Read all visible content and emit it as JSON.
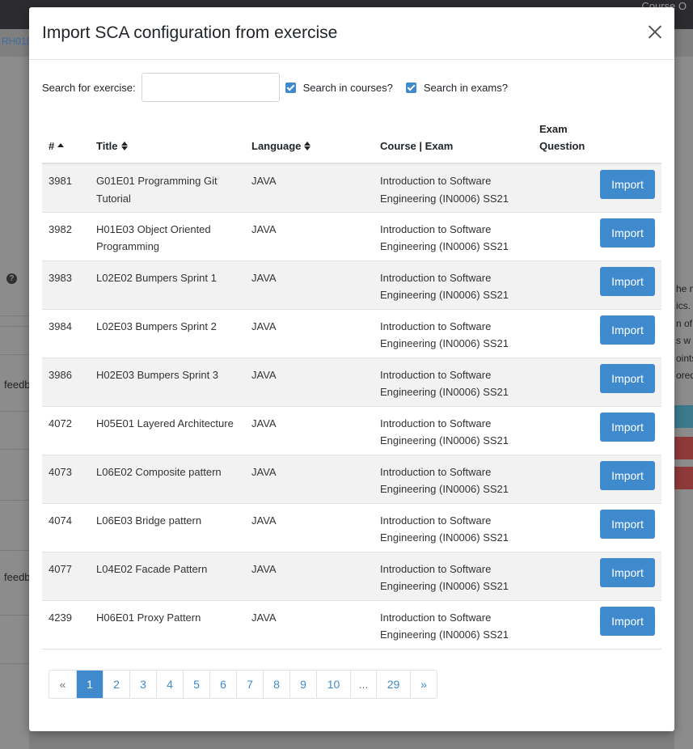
{
  "background": {
    "top_right_text": "Course O",
    "crumb": "RH01E",
    "feedback_1": "feedb",
    "feedback_2": "feedb",
    "right_texts": [
      "he m",
      "ics.",
      "n of",
      "s w",
      "oints",
      "ored"
    ],
    "accent_colors": {
      "teal": "#3a8aa0",
      "red": "#a33b3b"
    }
  },
  "modal": {
    "title": "Import SCA configuration from exercise",
    "close_icon": "close-icon",
    "search": {
      "label": "Search for exercise:",
      "value": "",
      "placeholder": "",
      "search_courses_label": "Search in courses?",
      "search_courses_checked": true,
      "search_exams_label": "Search in exams?",
      "search_exams_checked": true
    },
    "table": {
      "headers": {
        "id": "#",
        "title": "Title",
        "language": "Language",
        "course_exam": "Course | Exam",
        "exam_question": "Exam Question"
      },
      "import_label": "Import",
      "rows": [
        {
          "id": "3981",
          "title": "G01E01 Programming Git Tutorial",
          "language": "JAVA",
          "course": "Introduction to Software Engineering (IN0006) SS21",
          "exam_question": ""
        },
        {
          "id": "3982",
          "title": "H01E03 Object Oriented Programming",
          "language": "JAVA",
          "course": "Introduction to Software Engineering (IN0006) SS21",
          "exam_question": ""
        },
        {
          "id": "3983",
          "title": "L02E02 Bumpers Sprint 1",
          "language": "JAVA",
          "course": "Introduction to Software Engineering (IN0006) SS21",
          "exam_question": ""
        },
        {
          "id": "3984",
          "title": "L02E03 Bumpers Sprint 2",
          "language": "JAVA",
          "course": "Introduction to Software Engineering (IN0006) SS21",
          "exam_question": ""
        },
        {
          "id": "3986",
          "title": "H02E03 Bumpers Sprint 3",
          "language": "JAVA",
          "course": "Introduction to Software Engineering (IN0006) SS21",
          "exam_question": ""
        },
        {
          "id": "4072",
          "title": "H05E01 Layered Architecture",
          "language": "JAVA",
          "course": "Introduction to Software Engineering (IN0006) SS21",
          "exam_question": ""
        },
        {
          "id": "4073",
          "title": "L06E02 Composite pattern",
          "language": "JAVA",
          "course": "Introduction to Software Engineering (IN0006) SS21",
          "exam_question": ""
        },
        {
          "id": "4074",
          "title": "L06E03 Bridge pattern",
          "language": "JAVA",
          "course": "Introduction to Software Engineering (IN0006) SS21",
          "exam_question": ""
        },
        {
          "id": "4077",
          "title": "L04E02 Facade Pattern",
          "language": "JAVA",
          "course": "Introduction to Software Engineering (IN0006) SS21",
          "exam_question": ""
        },
        {
          "id": "4239",
          "title": "H06E01 Proxy Pattern",
          "language": "JAVA",
          "course": "Introduction to Software Engineering (IN0006) SS21",
          "exam_question": ""
        }
      ]
    },
    "pagination": {
      "prev": "«",
      "next": "»",
      "pages": [
        "1",
        "2",
        "3",
        "4",
        "5",
        "6",
        "7",
        "8",
        "9",
        "10",
        "...",
        "29"
      ],
      "active_page": "1"
    },
    "accent_color": "#3e8acc"
  }
}
